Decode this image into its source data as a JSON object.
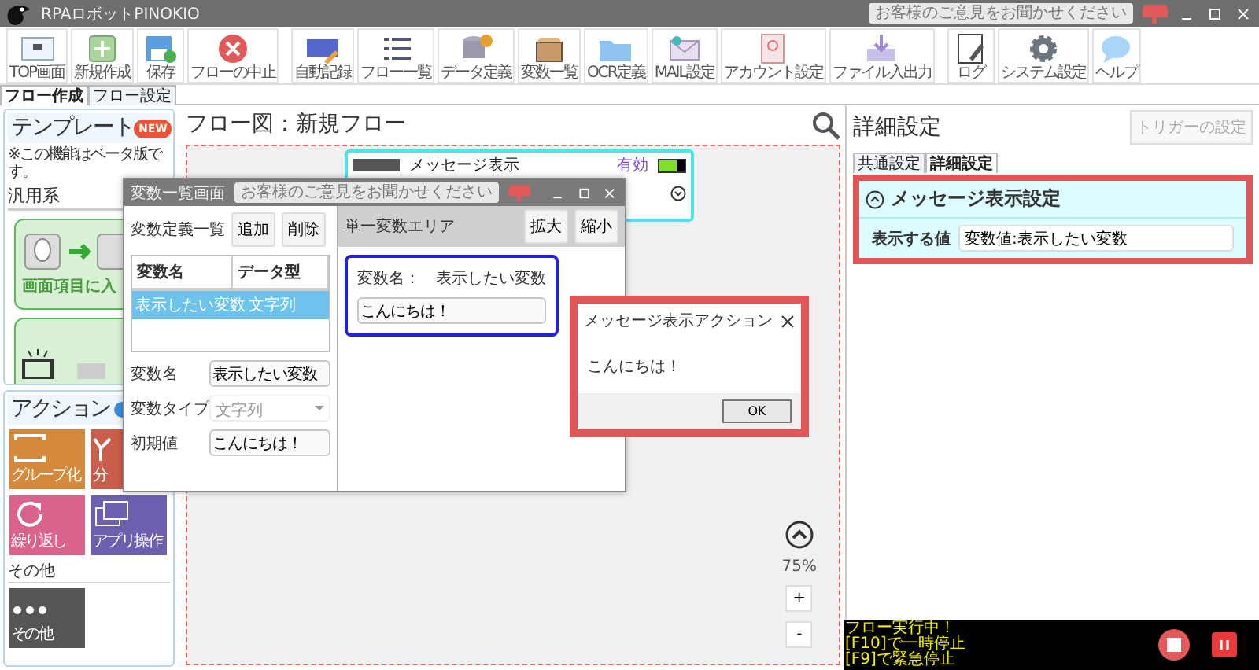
{
  "window": {
    "title": "RPAロボットPINOKIO",
    "feedback": "お客様のご意見をお聞かせください"
  },
  "toolbar": {
    "groups": [
      [
        {
          "label": "TOP画面"
        },
        {
          "label": "新規作成"
        },
        {
          "label": "保存"
        },
        {
          "label": "フローの中止"
        }
      ],
      [
        {
          "label": "自動記録"
        },
        {
          "label": "フロー一覧"
        },
        {
          "label": "データ定義"
        },
        {
          "label": "変数一覧"
        },
        {
          "label": "OCR定義"
        },
        {
          "label": "MAIL設定"
        },
        {
          "label": "アカウント設定"
        },
        {
          "label": "ファイル入出力"
        }
      ],
      [
        {
          "label": "ログ"
        },
        {
          "label": "システム設定"
        },
        {
          "label": "ヘルプ"
        }
      ]
    ]
  },
  "tabs": [
    {
      "label": "フロー作成",
      "selected": true
    },
    {
      "label": "フロー設定",
      "selected": false
    }
  ],
  "templates": {
    "title": "テンプレート",
    "badge": "NEW",
    "note": "※この機能はベータ版です。",
    "category": "汎用系",
    "cards": [
      {
        "kind": "input",
        "label": "画面項目に入"
      },
      {
        "kind": "open"
      }
    ]
  },
  "actions": {
    "title": "アクション",
    "tiles": [
      {
        "label": "グループ化",
        "color": "#d48a3a"
      },
      {
        "label": "分",
        "color": "#c95f4a"
      },
      {
        "label": "繰り返し",
        "color": "#d9638b"
      },
      {
        "label": "アプリ操作",
        "color": "#6d5fb0"
      }
    ],
    "other_heading": "その他",
    "other_tiles": [
      {
        "label": "その他",
        "color": "#555555"
      }
    ]
  },
  "flow": {
    "title": "フロー図：新規フロー",
    "node": {
      "title": "メッセージ表示",
      "state": "有効",
      "on": true
    },
    "zoom": "75%",
    "zoom_in": "+",
    "zoom_out": "-"
  },
  "details": {
    "title": "詳細設定",
    "trigger_button": {
      "label": "トリガーの設定",
      "disabled": true
    },
    "tabs": [
      {
        "label": "共通設定",
        "selected": false
      },
      {
        "label": "詳細設定",
        "selected": true
      }
    ],
    "section": {
      "title": "メッセージ表示設定",
      "expanded": true,
      "fields": [
        {
          "label": "表示する値",
          "value": "変数値:表示したい変数"
        }
      ]
    }
  },
  "variable_window": {
    "title": "変数一覧画面",
    "feedback": "お客様のご意見をお聞かせください",
    "list_title": "変数定義一覧",
    "add": "追加",
    "delete": "削除",
    "columns": [
      "変数名",
      "データ型"
    ],
    "rows": [
      {
        "cells": [
          "表示したい変数",
          "文字列"
        ],
        "selected": true
      }
    ],
    "form": [
      {
        "kind": "text",
        "label": "変数名",
        "value": "表示したい変数"
      },
      {
        "kind": "select",
        "label": "変数タイプ",
        "value": "文字列",
        "disabled": true
      },
      {
        "kind": "text",
        "label": "初期値",
        "value": "こんにちは！"
      }
    ],
    "area_title": "単一変数エリア",
    "zoom_in": "拡大",
    "zoom_out": "縮小",
    "card": {
      "label": "変数名：　表示したい変数",
      "value": "こんにちは！"
    }
  },
  "message_dialog": {
    "title": "メッセージ表示アクション",
    "message": "こんにちは！",
    "button": "OK"
  },
  "run_status": {
    "lines": [
      "フロー実行中！",
      "[F10]で一時停止",
      "[F9]で緊急停止"
    ]
  }
}
